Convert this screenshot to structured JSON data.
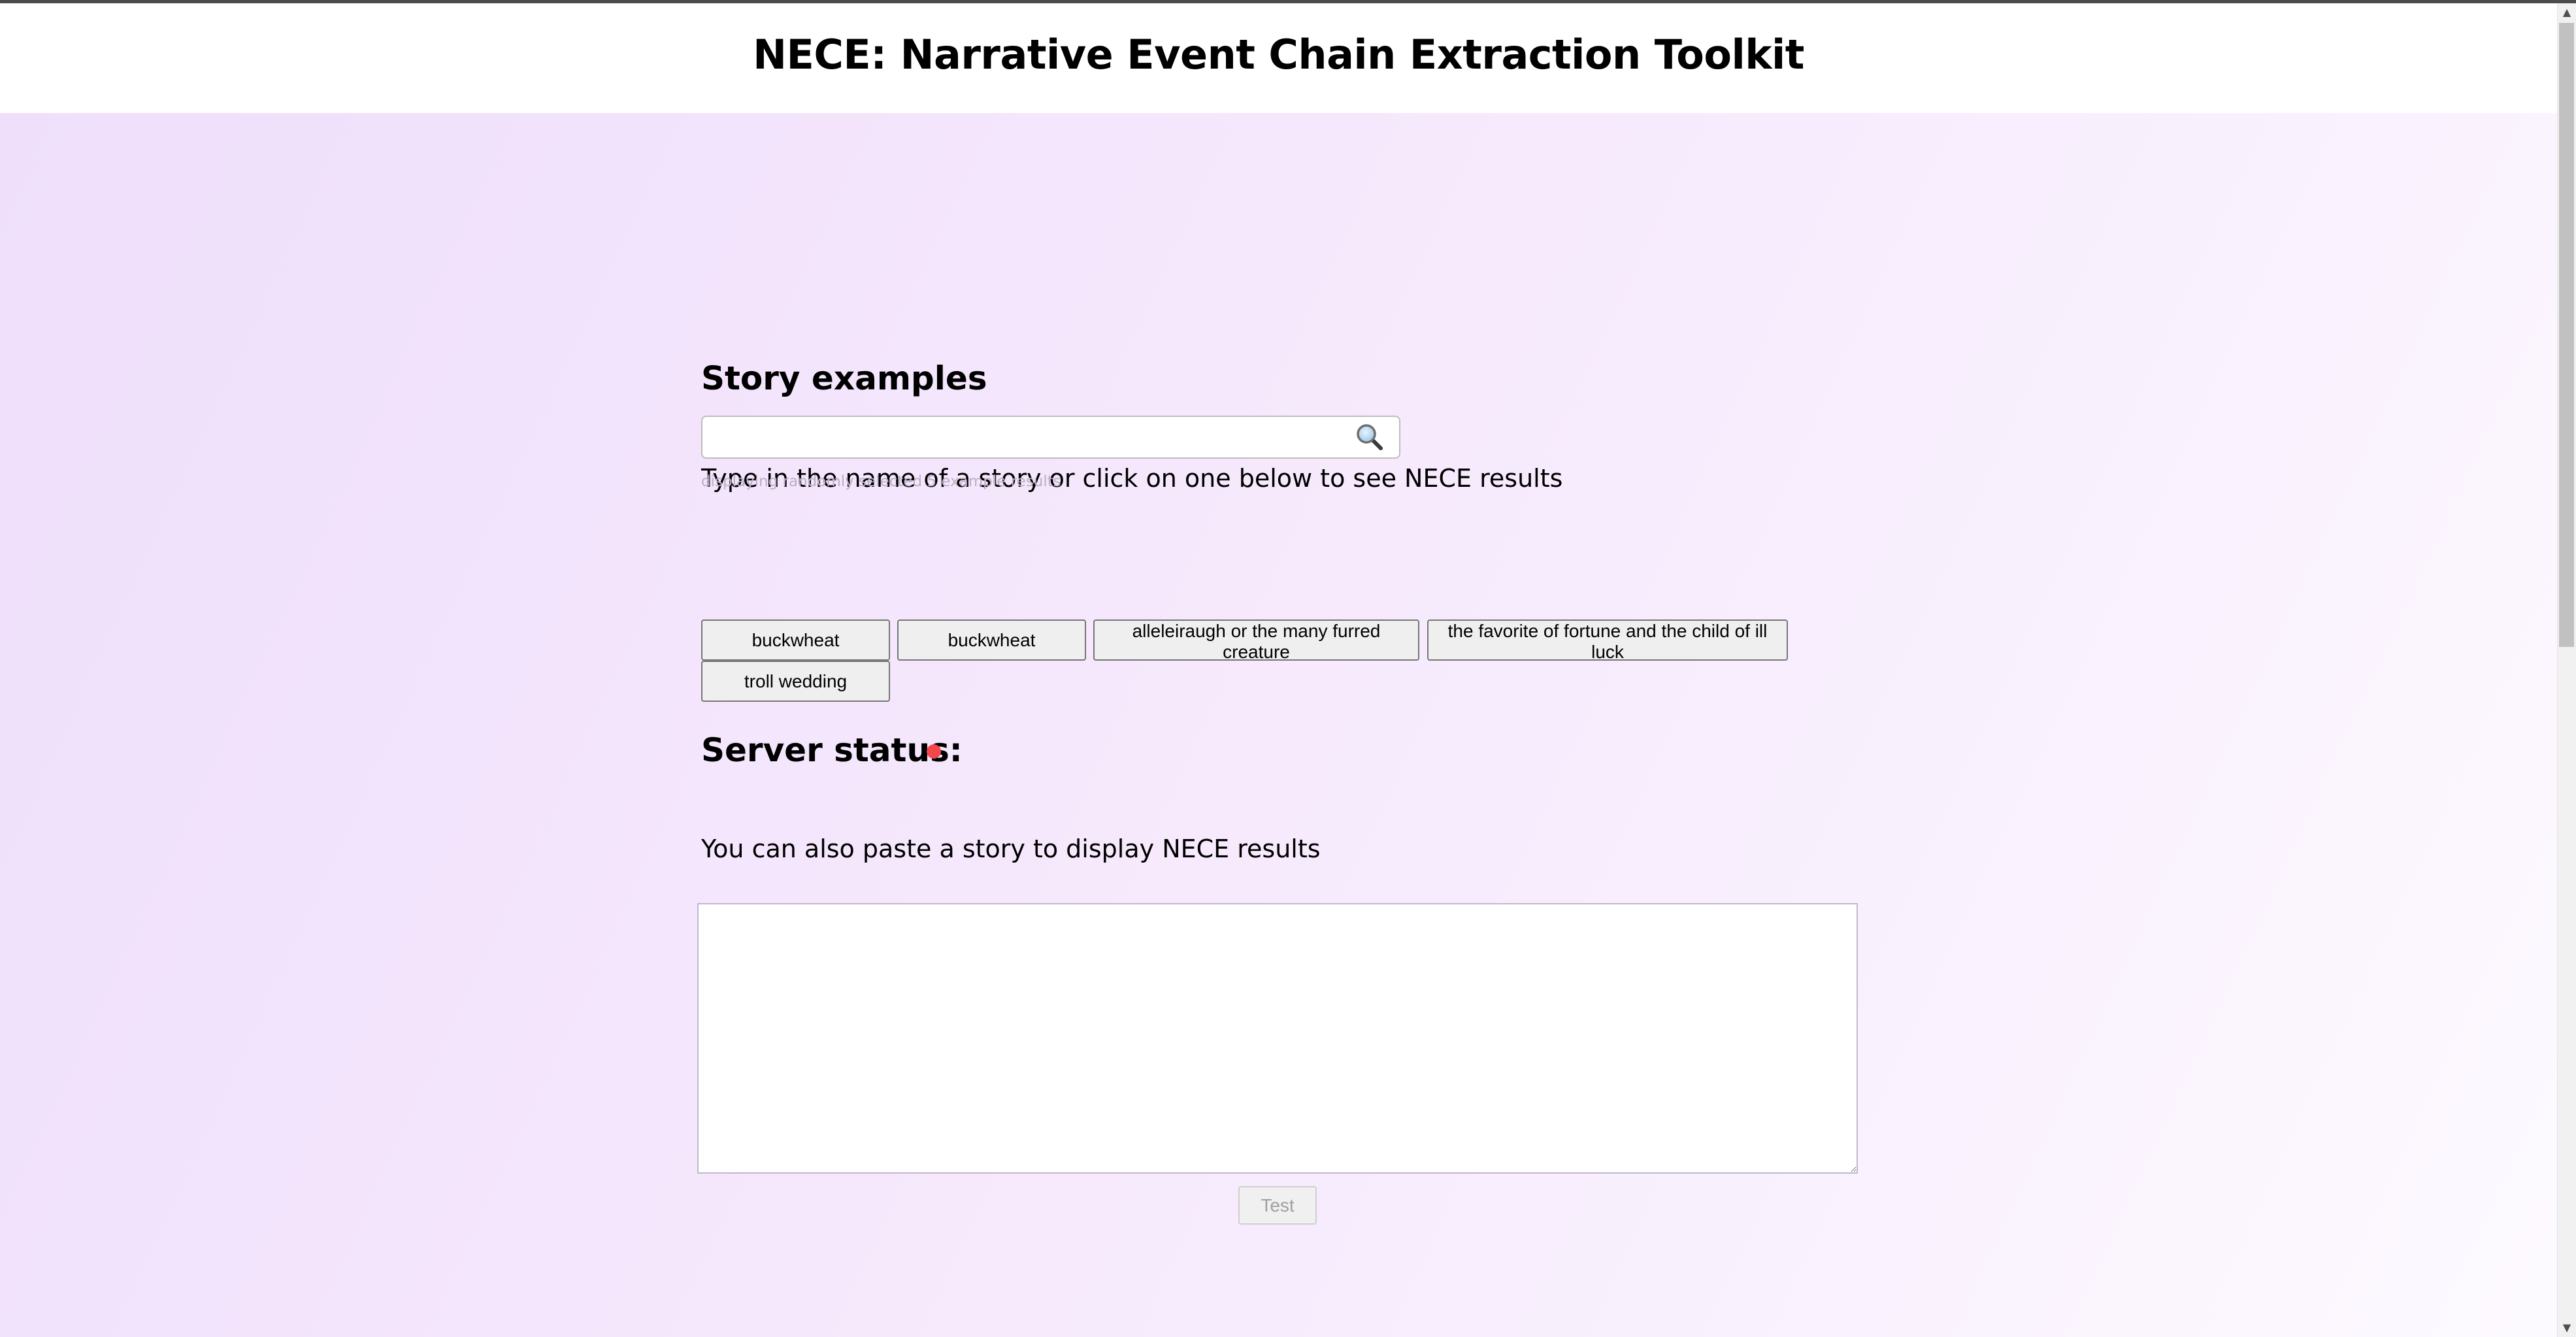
{
  "header": {
    "title": "NECE: Narrative Event Chain Extraction Toolkit"
  },
  "examples": {
    "heading": "Story examples",
    "instruction": "Type in the name of a story or click on one below to see NECE results",
    "search": {
      "value": "",
      "placeholder": "",
      "icon": "search-icon"
    },
    "hint": "displaying randomly selected 5 example results",
    "stories": [
      "buckwheat",
      "buckwheat",
      "alleleiraugh or the many furred creature",
      "the favorite of fortune and the child of ill luck",
      "troll wedding"
    ]
  },
  "server": {
    "heading": "Server status:",
    "status_color": "#f4474a"
  },
  "paste": {
    "instruction": "You can also paste a story to display NECE results",
    "textarea_value": "",
    "test_label": "Test"
  },
  "colors": {
    "background_start": "#efdffb",
    "background_end": "#fdfaff",
    "button_bg": "#efefef"
  }
}
